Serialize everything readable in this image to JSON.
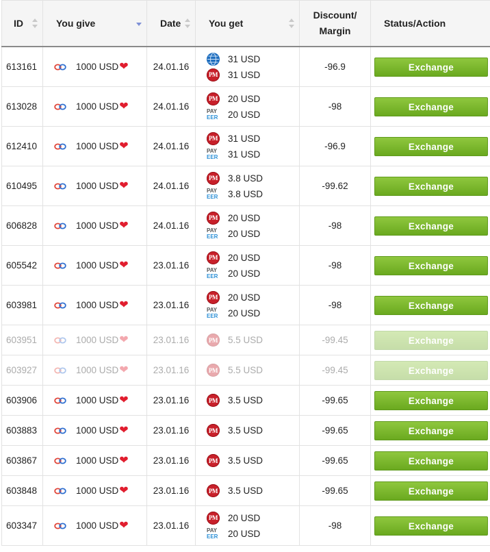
{
  "columns": {
    "id": "ID",
    "you_give": "You give",
    "date": "Date",
    "you_get": "You get",
    "discount_line1": "Discount/",
    "discount_line2": "Margin",
    "status": "Status/Action"
  },
  "sort": {
    "column": "you_give",
    "direction": "desc"
  },
  "colors": {
    "button_green": "#7ab82e",
    "heart_red": "#e11d2e",
    "pm_red": "#c8202a",
    "webmoney_blue": "#1e6dbe",
    "payeer_blue": "#2a8fd6"
  },
  "rows": [
    {
      "id": "613161",
      "give_icon": "chain-icon",
      "give": "1000 USD",
      "date": "24.01.16",
      "get": [
        {
          "icon": "webmoney-icon",
          "amount": "31 USD"
        },
        {
          "icon": "perfectmoney-icon",
          "amount": "31 USD"
        }
      ],
      "discount": "-96.9",
      "action": "Exchange",
      "faded": false
    },
    {
      "id": "613028",
      "give_icon": "chain-icon",
      "give": "1000 USD",
      "date": "24.01.16",
      "get": [
        {
          "icon": "perfectmoney-icon",
          "amount": "20 USD"
        },
        {
          "icon": "payeer-icon",
          "amount": "20 USD"
        }
      ],
      "discount": "-98",
      "action": "Exchange",
      "faded": false
    },
    {
      "id": "612410",
      "give_icon": "chain-icon",
      "give": "1000 USD",
      "date": "24.01.16",
      "get": [
        {
          "icon": "perfectmoney-icon",
          "amount": "31 USD"
        },
        {
          "icon": "payeer-icon",
          "amount": "31 USD"
        }
      ],
      "discount": "-96.9",
      "action": "Exchange",
      "faded": false
    },
    {
      "id": "610495",
      "give_icon": "chain-icon",
      "give": "1000 USD",
      "date": "24.01.16",
      "get": [
        {
          "icon": "perfectmoney-icon",
          "amount": "3.8 USD"
        },
        {
          "icon": "payeer-icon",
          "amount": "3.8 USD"
        }
      ],
      "discount": "-99.62",
      "action": "Exchange",
      "faded": false
    },
    {
      "id": "606828",
      "give_icon": "chain-icon",
      "give": "1000 USD",
      "date": "24.01.16",
      "get": [
        {
          "icon": "perfectmoney-icon",
          "amount": "20 USD"
        },
        {
          "icon": "payeer-icon",
          "amount": "20 USD"
        }
      ],
      "discount": "-98",
      "action": "Exchange",
      "faded": false
    },
    {
      "id": "605542",
      "give_icon": "chain-icon",
      "give": "1000 USD",
      "date": "23.01.16",
      "get": [
        {
          "icon": "perfectmoney-icon",
          "amount": "20 USD"
        },
        {
          "icon": "payeer-icon",
          "amount": "20 USD"
        }
      ],
      "discount": "-98",
      "action": "Exchange",
      "faded": false
    },
    {
      "id": "603981",
      "give_icon": "chain-icon",
      "give": "1000 USD",
      "date": "23.01.16",
      "get": [
        {
          "icon": "perfectmoney-icon",
          "amount": "20 USD"
        },
        {
          "icon": "payeer-icon",
          "amount": "20 USD"
        }
      ],
      "discount": "-98",
      "action": "Exchange",
      "faded": false
    },
    {
      "id": "603951",
      "give_icon": "chain-icon",
      "give": "1000 USD",
      "date": "23.01.16",
      "get": [
        {
          "icon": "perfectmoney-icon",
          "amount": "5.5 USD"
        }
      ],
      "discount": "-99.45",
      "action": "Exchange",
      "faded": true
    },
    {
      "id": "603927",
      "give_icon": "chain-icon",
      "give": "1000 USD",
      "date": "23.01.16",
      "get": [
        {
          "icon": "perfectmoney-icon",
          "amount": "5.5 USD"
        }
      ],
      "discount": "-99.45",
      "action": "Exchange",
      "faded": true
    },
    {
      "id": "603906",
      "give_icon": "chain-icon",
      "give": "1000 USD",
      "date": "23.01.16",
      "get": [
        {
          "icon": "perfectmoney-icon",
          "amount": "3.5 USD"
        }
      ],
      "discount": "-99.65",
      "action": "Exchange",
      "faded": false
    },
    {
      "id": "603883",
      "give_icon": "chain-icon",
      "give": "1000 USD",
      "date": "23.01.16",
      "get": [
        {
          "icon": "perfectmoney-icon",
          "amount": "3.5 USD"
        }
      ],
      "discount": "-99.65",
      "action": "Exchange",
      "faded": false
    },
    {
      "id": "603867",
      "give_icon": "chain-icon",
      "give": "1000 USD",
      "date": "23.01.16",
      "get": [
        {
          "icon": "perfectmoney-icon",
          "amount": "3.5 USD"
        }
      ],
      "discount": "-99.65",
      "action": "Exchange",
      "faded": false
    },
    {
      "id": "603848",
      "give_icon": "chain-icon",
      "give": "1000 USD",
      "date": "23.01.16",
      "get": [
        {
          "icon": "perfectmoney-icon",
          "amount": "3.5 USD"
        }
      ],
      "discount": "-99.65",
      "action": "Exchange",
      "faded": false
    },
    {
      "id": "603347",
      "give_icon": "chain-icon",
      "give": "1000 USD",
      "date": "23.01.16",
      "get": [
        {
          "icon": "perfectmoney-icon",
          "amount": "20 USD"
        },
        {
          "icon": "payeer-icon",
          "amount": "20 USD"
        }
      ],
      "discount": "-98",
      "action": "Exchange",
      "faded": false
    }
  ]
}
